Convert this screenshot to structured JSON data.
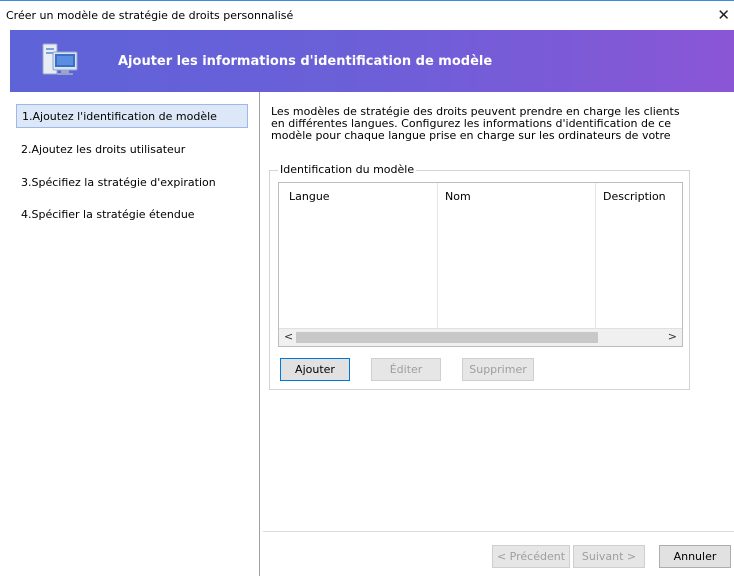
{
  "window": {
    "title": "Créer un modèle de stratégie de droits personnalisé",
    "close_glyph": "✕"
  },
  "banner": {
    "title": "Ajouter les informations d'identification de modèle",
    "icon": "computer-screen-icon"
  },
  "steps": [
    {
      "label": "1.Ajoutez l'identification de modèle",
      "active": true
    },
    {
      "label": "2.Ajoutez les droits utilisateur",
      "active": false
    },
    {
      "label": "3.Spécifiez la stratégie d'expiration",
      "active": false
    },
    {
      "label": "4.Spécifier la stratégie étendue",
      "active": false
    }
  ],
  "description": {
    "line1": "Les modèles de stratégie des droits peuvent prendre en charge les clients",
    "line2": "en différentes langues. Configurez les informations d'identification de ce",
    "line3": "modèle pour chaque langue prise en charge sur les ordinateurs de votre"
  },
  "group": {
    "legend": "Identification du modèle"
  },
  "table": {
    "columns": [
      "Langue",
      "Nom",
      "Description"
    ],
    "scroll_left": "<",
    "scroll_right": ">"
  },
  "buttons": {
    "add": "Ajouter",
    "edit": "Éditer",
    "delete": "Supprimer"
  },
  "footer": {
    "previous": "< Précédent",
    "next": "Suivant >",
    "cancel": "Annuler"
  },
  "colors": {
    "banner_start": "#5e63d8",
    "banner_end": "#8a56d6",
    "accent": "#0078d7"
  }
}
